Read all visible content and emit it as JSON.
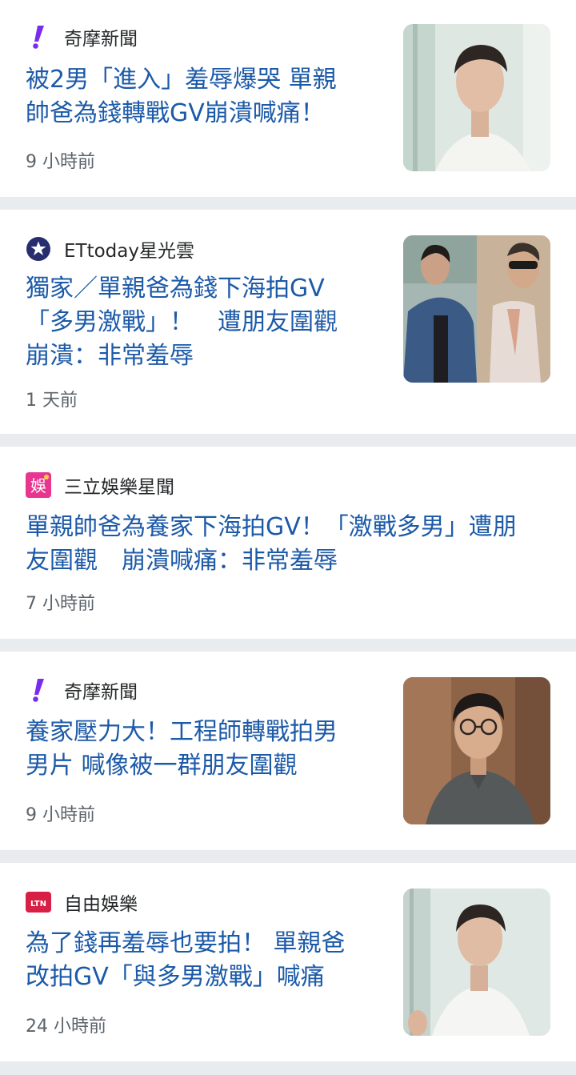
{
  "articles": [
    {
      "source": "奇摩新聞",
      "source_icon": "yahoo-exclamation-icon",
      "headline_lines": [
        "被2男「進入」羞辱爆哭 單親",
        "帥爸為錢轉戰GV崩潰喊痛！"
      ],
      "time": "9 小時前",
      "has_thumbnail": true
    },
    {
      "source": "ETtoday星光雲",
      "source_icon": "ettoday-star-icon",
      "headline_lines": [
        "獨家／單親爸為錢下海拍GV",
        "「多男激戰」！　遭朋友圍觀",
        "崩潰：非常羞辱"
      ],
      "time": "1 天前",
      "has_thumbnail": true
    },
    {
      "source": "三立娛樂星聞",
      "source_icon": "setn-entertainment-icon",
      "source_icon_text": "娛",
      "headline_lines": [
        "單親帥爸為養家下海拍GV！「激戰多男」遭朋",
        "友圍觀　崩潰喊痛：非常羞辱"
      ],
      "time": "7 小時前",
      "has_thumbnail": false
    },
    {
      "source": "奇摩新聞",
      "source_icon": "yahoo-exclamation-icon",
      "headline_lines": [
        "養家壓力大！工程師轉戰拍男",
        "男片 喊像被一群朋友圍觀"
      ],
      "time": "9 小時前",
      "has_thumbnail": true
    },
    {
      "source": "自由娛樂",
      "source_icon": "ltn-logo-icon",
      "source_icon_text": "LTN",
      "headline_lines": [
        "為了錢再羞辱也要拍！ 單親爸",
        "改拍GV「與多男激戰」喊痛"
      ],
      "time": "24 小時前",
      "has_thumbnail": true
    }
  ],
  "colors": {
    "headline": "#1c5aa8",
    "yahoo_purple": "#7b2bf0",
    "ettoday_navy": "#272e6d",
    "setn_pink": "#e8358f",
    "ltn_red": "#d81f45",
    "divider": "#e9ecef"
  }
}
